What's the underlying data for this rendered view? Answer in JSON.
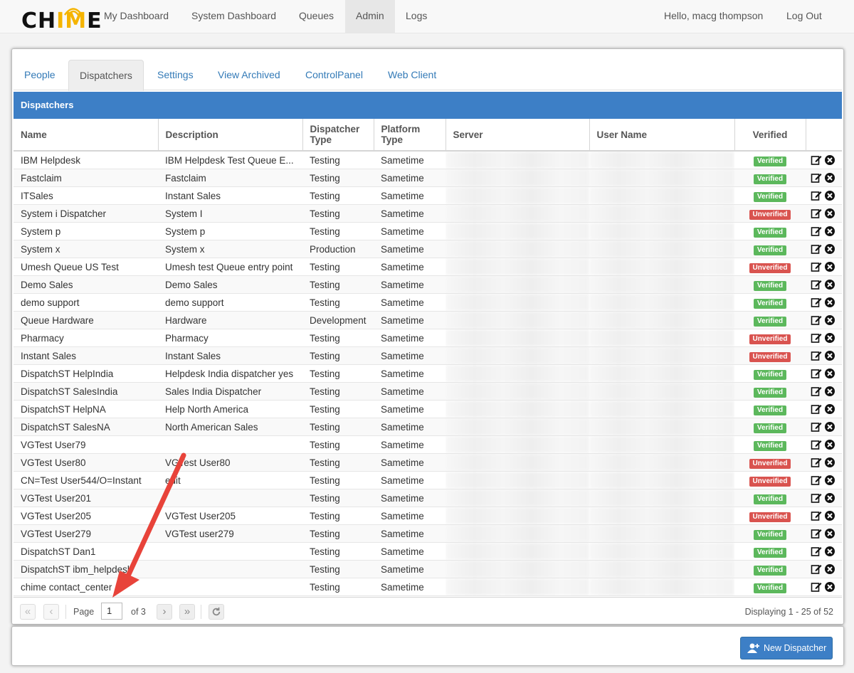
{
  "nav": {
    "logo": "CHIME",
    "items": [
      {
        "label": "My Dashboard"
      },
      {
        "label": "System Dashboard"
      },
      {
        "label": "Queues"
      },
      {
        "label": "Admin"
      },
      {
        "label": "Logs"
      }
    ],
    "greeting": "Hello, macg thompson",
    "logout": "Log Out"
  },
  "tabs": [
    {
      "label": "People"
    },
    {
      "label": "Dispatchers"
    },
    {
      "label": "Settings"
    },
    {
      "label": "View Archived"
    },
    {
      "label": "ControlPanel"
    },
    {
      "label": "Web Client"
    }
  ],
  "grid": {
    "title": "Dispatchers",
    "columns": [
      "Name",
      "Description",
      "Dispatcher Type",
      "Platform Type",
      "Server",
      "User Name",
      "Verified"
    ],
    "rows": [
      {
        "name": "IBM Helpdesk",
        "description": "IBM Helpdesk Test Queue E...",
        "type": "Testing",
        "platform": "Sametime",
        "verified": "Verified"
      },
      {
        "name": "Fastclaim",
        "description": "Fastclaim",
        "type": "Testing",
        "platform": "Sametime",
        "verified": "Verified"
      },
      {
        "name": "ITSales",
        "description": "Instant Sales",
        "type": "Testing",
        "platform": "Sametime",
        "verified": "Verified"
      },
      {
        "name": "System i Dispatcher",
        "description": "System I",
        "type": "Testing",
        "platform": "Sametime",
        "verified": "Unverified"
      },
      {
        "name": "System p",
        "description": "System p",
        "type": "Testing",
        "platform": "Sametime",
        "verified": "Verified"
      },
      {
        "name": "System x",
        "description": "System x",
        "type": "Production",
        "platform": "Sametime",
        "verified": "Verified"
      },
      {
        "name": "Umesh Queue US Test",
        "description": "Umesh test Queue entry point",
        "type": "Testing",
        "platform": "Sametime",
        "verified": "Unverified"
      },
      {
        "name": "Demo Sales",
        "description": "Demo Sales",
        "type": "Testing",
        "platform": "Sametime",
        "verified": "Verified"
      },
      {
        "name": "demo support",
        "description": "demo support",
        "type": "Testing",
        "platform": "Sametime",
        "verified": "Verified"
      },
      {
        "name": "Queue Hardware",
        "description": "Hardware",
        "type": "Development",
        "platform": "Sametime",
        "verified": "Verified"
      },
      {
        "name": "Pharmacy",
        "description": "Pharmacy",
        "type": "Testing",
        "platform": "Sametime",
        "verified": "Unverified"
      },
      {
        "name": "Instant Sales",
        "description": "Instant Sales",
        "type": "Testing",
        "platform": "Sametime",
        "verified": "Unverified"
      },
      {
        "name": "DispatchST HelpIndia",
        "description": "Helpdesk India dispatcher yes",
        "type": "Testing",
        "platform": "Sametime",
        "verified": "Verified"
      },
      {
        "name": "DispatchST SalesIndia",
        "description": "Sales India Dispatcher",
        "type": "Testing",
        "platform": "Sametime",
        "verified": "Verified"
      },
      {
        "name": "DispatchST HelpNA",
        "description": "Help North America",
        "type": "Testing",
        "platform": "Sametime",
        "verified": "Verified"
      },
      {
        "name": "DispatchST SalesNA",
        "description": "North American Sales",
        "type": "Testing",
        "platform": "Sametime",
        "verified": "Verified"
      },
      {
        "name": "VGTest User79",
        "description": "",
        "type": "Testing",
        "platform": "Sametime",
        "verified": "Verified"
      },
      {
        "name": "VGTest User80",
        "description": "VGTest User80",
        "type": "Testing",
        "platform": "Sametime",
        "verified": "Unverified"
      },
      {
        "name": "CN=Test User544/O=Instant",
        "description": "edit",
        "type": "Testing",
        "platform": "Sametime",
        "verified": "Unverified"
      },
      {
        "name": "VGTest User201",
        "description": "",
        "type": "Testing",
        "platform": "Sametime",
        "verified": "Verified"
      },
      {
        "name": "VGTest User205",
        "description": "VGTest User205",
        "type": "Testing",
        "platform": "Sametime",
        "verified": "Unverified"
      },
      {
        "name": "VGTest User279",
        "description": "VGTest user279",
        "type": "Testing",
        "platform": "Sametime",
        "verified": "Verified"
      },
      {
        "name": "DispatchST Dan1",
        "description": "",
        "type": "Testing",
        "platform": "Sametime",
        "verified": "Verified"
      },
      {
        "name": "DispatchST ibm_helpdesk",
        "description": "",
        "type": "Testing",
        "platform": "Sametime",
        "verified": "Verified"
      },
      {
        "name": "chime contact_center",
        "description": "",
        "type": "Testing",
        "platform": "Sametime",
        "verified": "Verified"
      }
    ]
  },
  "pager": {
    "page_label": "Page",
    "page_value": "1",
    "of_label": "of 3",
    "display": "Displaying 1 - 25 of 52"
  },
  "new_button": "New Dispatcher",
  "colors": {
    "accent": "#3d7fc6",
    "verified": "#5cb85c",
    "unverified": "#d9534f",
    "annotation_arrow": "#e8433a"
  }
}
